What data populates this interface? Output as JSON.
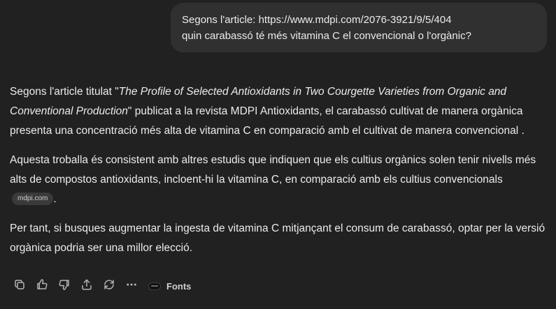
{
  "user_message": {
    "line1": "Segons l'article: https://www.mdpi.com/2076-3921/9/5/404",
    "line2": "quin carabassó té més vitamina C el convencional o l'orgànic?"
  },
  "answer": {
    "p1_before": "Segons l'article titulat \"",
    "p1_title": "The Profile of Selected Antioxidants in Two Courgette Varieties from Organic and Conventional Production",
    "p1_after": "\" publicat a la revista MDPI Antioxidants, el carabassó cultivat de manera orgànica presenta una concentració més alta de vitamina C en comparació amb el cultivat de manera convencional .",
    "p2_text": "Aquesta troballa és consistent amb altres estudis que indiquen que els cultius orgànics solen tenir nivells més alts de compostos antioxidants, incloent-hi la vitamina C, en comparació amb els cultius convencionals",
    "p2_source": "mdpi.com",
    "p2_end": ".",
    "p3_text": "Per tant, si busques augmentar la ingesta de vitamina C mitjançant el consum de carabassó, optar per la versió orgànica podria ser una millor elecció."
  },
  "toolbar": {
    "icons": [
      "copy-icon",
      "thumbs-up-icon",
      "thumbs-down-icon",
      "share-icon",
      "regenerate-icon",
      "more-icon"
    ],
    "fonts_label": "Fonts"
  }
}
